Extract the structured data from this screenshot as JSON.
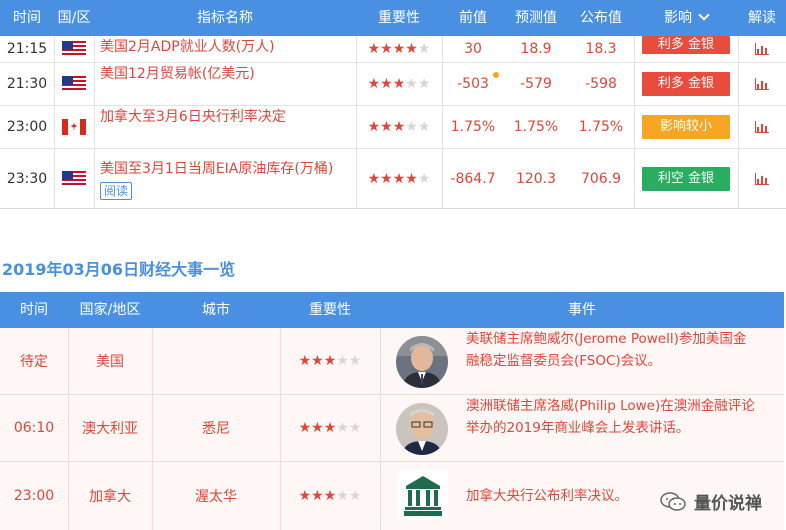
{
  "top_table": {
    "headers": [
      "时间",
      "国/区",
      "指标名称",
      "重要性",
      "前值",
      "预测值",
      "公布值",
      "影响",
      "解读"
    ],
    "rows": [
      {
        "time": "21:15",
        "flag": "us-flag",
        "indicator": "美国2月ADP就业人数(万人)",
        "stars": 4,
        "prev": "30",
        "forecast": "18.9",
        "actual": "18.3",
        "impact": "利多 金银",
        "impact_color": "#e74c3c",
        "tag": ""
      },
      {
        "time": "21:30",
        "flag": "us-flag",
        "indicator": "美国12月贸易帐(亿美元)",
        "stars": 3,
        "prev": "-503",
        "forecast": "-579",
        "actual": "-598",
        "impact": "利多 金银",
        "impact_color": "#e74c3c",
        "tag": ""
      },
      {
        "time": "23:00",
        "flag": "ca-flag",
        "indicator": "加拿大至3月6日央行利率决定",
        "stars": 3,
        "prev": "1.75%",
        "forecast": "1.75%",
        "actual": "1.75%",
        "impact": "影响较小",
        "impact_color": "#f5a623",
        "tag": ""
      },
      {
        "time": "23:30",
        "flag": "us-flag",
        "indicator": "美国至3月1日当周EIA原油库存(万桶)",
        "stars": 4,
        "prev": "-864.7",
        "forecast": "120.3",
        "actual": "706.9",
        "impact": "利空 金银",
        "impact_color": "#27ae60",
        "tag": "阅读"
      }
    ]
  },
  "section_title": "2019年03月06日财经大事一览",
  "events_table": {
    "headers": [
      "时间",
      "国家/地区",
      "城市",
      "重要性",
      "事件"
    ],
    "rows": [
      {
        "time": "待定",
        "country": "美国",
        "city": "",
        "stars": 3,
        "line1": "美联储主席鲍威尔(Jerome Powell)参加美国金",
        "line2": "融稳定监督委员会(FSOC)会议。",
        "image": "person-photo"
      },
      {
        "time": "06:10",
        "country": "澳大利亚",
        "city": "悉尼",
        "stars": 3,
        "line1": "澳洲联储主席洛威(Philip Lowe)在澳洲金融评论",
        "line2": "举办的2019年商业峰会上发表讲话。",
        "image": "person-photo"
      },
      {
        "time": "23:00",
        "country": "加拿大",
        "city": "渥太华",
        "stars": 3,
        "line1": "加拿大央行公布利率决议。",
        "line2": "",
        "image": "bank-of-canada-logo"
      }
    ]
  },
  "watermark": "量价说禅"
}
